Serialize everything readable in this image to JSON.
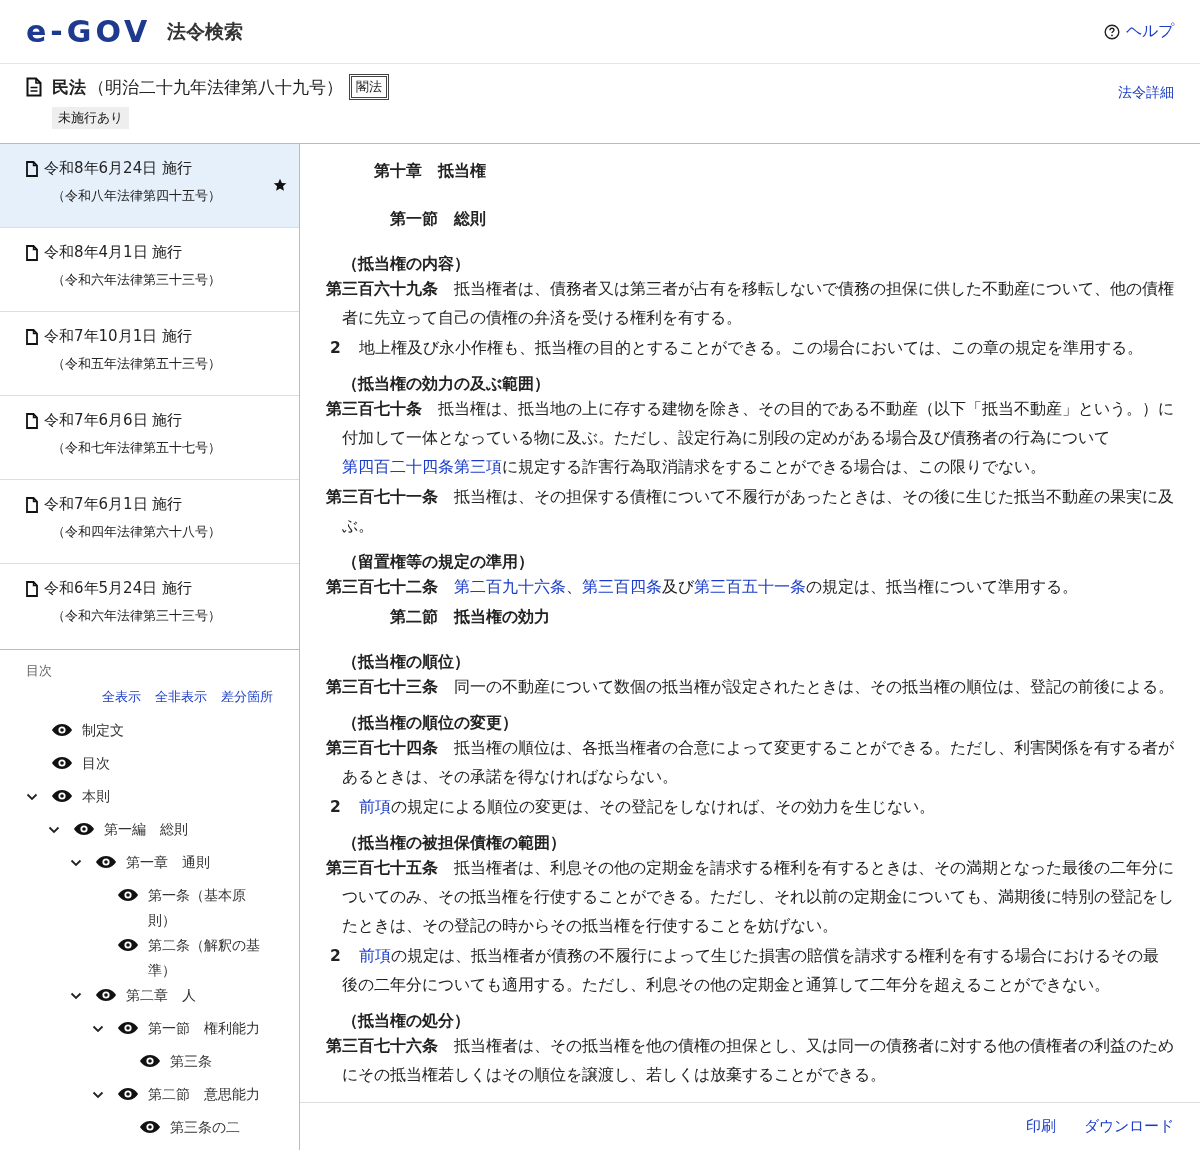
{
  "header": {
    "logo": "e-GOV",
    "title": "法令検索",
    "help": "ヘルプ"
  },
  "law": {
    "name": "民法",
    "number": "（明治二十九年法律第八十九号）",
    "badge": "閣法",
    "tag": "未施行あり",
    "details_link": "法令詳細"
  },
  "versions": [
    {
      "date": "令和8年6月24日 施行",
      "law": "（令和八年法律第四十五号）",
      "selected": true
    },
    {
      "date": "令和8年4月1日 施行",
      "law": "（令和六年法律第三十三号）",
      "selected": false
    },
    {
      "date": "令和7年10月1日 施行",
      "law": "（令和五年法律第五十三号）",
      "selected": false
    },
    {
      "date": "令和7年6月6日 施行",
      "law": "（令和七年法律第五十七号）",
      "selected": false
    },
    {
      "date": "令和7年6月1日 施行",
      "law": "（令和四年法律第六十八号）",
      "selected": false
    },
    {
      "date": "令和6年5月24日 施行",
      "law": "（令和六年法律第三十三号）",
      "selected": false
    }
  ],
  "toc": {
    "title": "目次",
    "actions": [
      "全表示",
      "全非表示",
      "差分箇所"
    ],
    "items": [
      {
        "label": "制定文"
      },
      {
        "label": "目次"
      },
      {
        "label": "本則",
        "expanded": true,
        "children": [
          {
            "label": "第一編　総則",
            "expanded": true,
            "children": [
              {
                "label": "第一章　通則",
                "expanded": true,
                "children": [
                  {
                    "label": "第一条（基本原則）"
                  },
                  {
                    "label": "第二条（解釈の基準）"
                  }
                ]
              },
              {
                "label": "第二章　人",
                "expanded": true,
                "children": [
                  {
                    "label": "第一節　権利能力",
                    "expanded": true,
                    "children": [
                      {
                        "label": "第三条"
                      }
                    ]
                  },
                  {
                    "label": "第二節　意思能力",
                    "expanded": true,
                    "children": [
                      {
                        "label": "第三条の二"
                      }
                    ]
                  }
                ]
              }
            ]
          }
        ]
      }
    ]
  },
  "content": [
    {
      "kind": "chapter",
      "text": "第十章　抵当権"
    },
    {
      "kind": "section",
      "text": "第一節　総則"
    },
    {
      "kind": "caption",
      "text": "（抵当権の内容）"
    },
    {
      "kind": "article",
      "number": "第三百六十九条",
      "segments": [
        {
          "text": "抵当権者は、債務者又は第三者が占有を移転しないで債務の担保に供した不動産について、他の債権者に先立って自己の債権の弁済を受ける権利を有する。"
        }
      ]
    },
    {
      "kind": "paragraph",
      "number": "2",
      "segments": [
        {
          "text": "地上権及び永小作権も、抵当権の目的とすることができる。この場合においては、この章の規定を準用する。"
        }
      ]
    },
    {
      "kind": "caption",
      "text": "（抵当権の効力の及ぶ範囲）"
    },
    {
      "kind": "article",
      "number": "第三百七十条",
      "segments": [
        {
          "text": "抵当権は、抵当地の上に存する建物を除き、その目的である不動産（以下「抵当不動産」という。）に付加して一体となっている物に及ぶ。ただし、設定行為に別段の定めがある場合及び債務者の行為について"
        },
        {
          "text": "第四百二十四条第三項",
          "link": true
        },
        {
          "text": "に規定する詐害行為取消請求をすることができる場合は、この限りでない。"
        }
      ]
    },
    {
      "kind": "article",
      "number": "第三百七十一条",
      "segments": [
        {
          "text": "抵当権は、その担保する債権について不履行があったときは、その後に生じた抵当不動産の果実に及ぶ。"
        }
      ]
    },
    {
      "kind": "caption",
      "text": "（留置権等の規定の準用）"
    },
    {
      "kind": "article",
      "number": "第三百七十二条",
      "segments": [
        {
          "text": "第二百九十六条",
          "link": true
        },
        {
          "text": "、"
        },
        {
          "text": "第三百四条",
          "link": true
        },
        {
          "text": "及び"
        },
        {
          "text": "第三百五十一条",
          "link": true
        },
        {
          "text": "の規定は、抵当権について準用する。"
        }
      ]
    },
    {
      "kind": "section",
      "text": "第二節　抵当権の効力"
    },
    {
      "kind": "caption",
      "text": "（抵当権の順位）"
    },
    {
      "kind": "article",
      "number": "第三百七十三条",
      "segments": [
        {
          "text": "同一の不動産について数個の抵当権が設定されたときは、その抵当権の順位は、登記の前後による。"
        }
      ]
    },
    {
      "kind": "caption",
      "text": "（抵当権の順位の変更）"
    },
    {
      "kind": "article",
      "number": "第三百七十四条",
      "segments": [
        {
          "text": "抵当権の順位は、各抵当権者の合意によって変更することができる。ただし、利害関係を有する者があるときは、その承諾を得なければならない。"
        }
      ]
    },
    {
      "kind": "paragraph",
      "number": "2",
      "segments": [
        {
          "text": "前項",
          "link": true
        },
        {
          "text": "の規定による順位の変更は、その登記をしなければ、その効力を生じない。"
        }
      ]
    },
    {
      "kind": "caption",
      "text": "（抵当権の被担保債権の範囲）"
    },
    {
      "kind": "article",
      "number": "第三百七十五条",
      "segments": [
        {
          "text": "抵当権者は、利息その他の定期金を請求する権利を有するときは、その満期となった最後の二年分についてのみ、その抵当権を行使することができる。ただし、それ以前の定期金についても、満期後に特別の登記をしたときは、その登記の時からその抵当権を行使することを妨げない。"
        }
      ]
    },
    {
      "kind": "paragraph",
      "number": "2",
      "segments": [
        {
          "text": "前項",
          "link": true
        },
        {
          "text": "の規定は、抵当権者が債務の不履行によって生じた損害の賠償を請求する権利を有する場合におけるその最後の二年分についても適用する。ただし、利息その他の定期金と通算して二年分を超えることができない。"
        }
      ]
    },
    {
      "kind": "caption",
      "text": "（抵当権の処分）"
    },
    {
      "kind": "article",
      "number": "第三百七十六条",
      "segments": [
        {
          "text": "抵当権者は、その抵当権を他の債権の担保とし、又は同一の債務者に対する他の債権者の利益のためにその抵当権若しくはその順位を譲渡し、若しくは放棄することができる。"
        }
      ]
    }
  ],
  "footer": [
    "印刷",
    "ダウンロード"
  ]
}
